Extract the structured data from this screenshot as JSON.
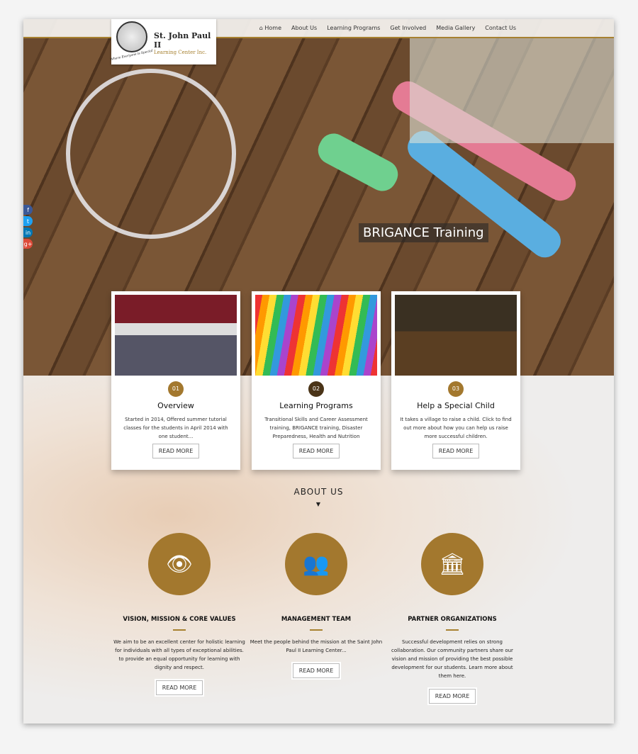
{
  "brand": {
    "name": "St. John Paul II",
    "subtitle": "Learning Center Inc.",
    "tagline": "Where Everyone is Special"
  },
  "nav": [
    {
      "label": "Home",
      "icon": "home-icon"
    },
    {
      "label": "About Us"
    },
    {
      "label": "Learning Programs"
    },
    {
      "label": "Get Involved"
    },
    {
      "label": "Media Gallery"
    },
    {
      "label": "Contact Us"
    }
  ],
  "hero": {
    "slide_title": "BRIGANCE Training"
  },
  "social": [
    {
      "icon": "facebook-icon",
      "glyph": "f",
      "color": "#3b5998"
    },
    {
      "icon": "twitter-icon",
      "glyph": "t",
      "color": "#1da1f2"
    },
    {
      "icon": "linkedin-icon",
      "glyph": "in",
      "color": "#0077b5"
    },
    {
      "icon": "google-plus-icon",
      "glyph": "g+",
      "color": "#dd4b39"
    }
  ],
  "cards": [
    {
      "num": "01",
      "num_color": "#a3782e",
      "title": "Overview",
      "text": "Started in 2014, Offered summer tutorial classes for the students in April 2014 with one student...",
      "button": "READ MORE"
    },
    {
      "num": "02",
      "num_color": "#4a3418",
      "title": "Learning Programs",
      "text": "Transitional Skills and Career Assessment training, BRIGANCE training, Disaster Preparedness, Health and Nutrition",
      "button": "READ MORE"
    },
    {
      "num": "03",
      "num_color": "#a3782e",
      "title": "Help a Special Child",
      "text": "It takes a village to raise a child. Click to find out more about how you can help us raise more successful children.",
      "button": "READ MORE"
    }
  ],
  "about": {
    "title": "ABOUT US",
    "items": [
      {
        "icon": "eye-icon",
        "glyph": "👁",
        "title": "VISION, MISSION & CORE VALUES",
        "text": "We aim to be an excellent center for holistic learning for individuals with all types of exceptional abilities. to provide an equal opportunity for learning with dignity and respect.",
        "button": "READ MORE"
      },
      {
        "icon": "users-icon",
        "glyph": "👥",
        "title": "MANAGEMENT TEAM",
        "text": "Meet the people behind the mission at the Saint John Paul II Learning Center...",
        "button": "READ MORE"
      },
      {
        "icon": "bank-icon",
        "glyph": "🏛",
        "title": "PARTNER ORGANIZATIONS",
        "text": "Successful development relies on strong collaboration. Our community partners share our vision and mission of providing the best possible development for our students. Learn more about them here.",
        "button": "READ MORE"
      }
    ]
  },
  "accent": "#a78130"
}
